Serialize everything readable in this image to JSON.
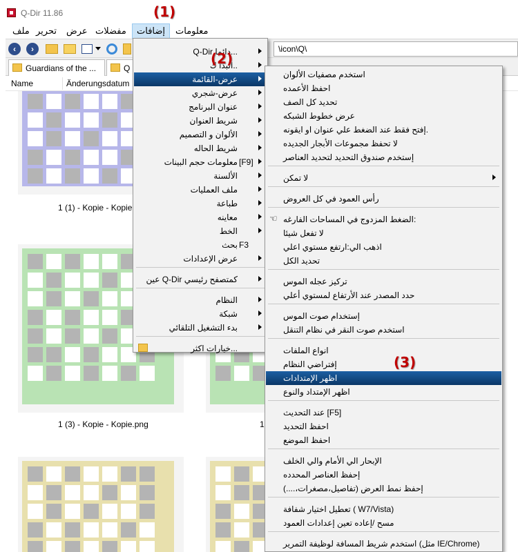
{
  "window": {
    "title": "Q-Dir 11.86"
  },
  "menubar": {
    "file": "ملف",
    "edit": "تحرير",
    "view": "عرض",
    "favorites": "مفضلات",
    "extras": "إضافات",
    "info": "معلومات"
  },
  "toolbar": {
    "path": "\\icon\\Q\\"
  },
  "tabs": [
    {
      "label": "Guardians of the ..."
    },
    {
      "label": "Q"
    }
  ],
  "columns": {
    "name": "Name",
    "modified": "Änderungsdatum"
  },
  "thumbnails": [
    {
      "caption": "1 (1) - Kopie - Kopie.png",
      "color": "#b7b7ea"
    },
    {
      "caption": "1 (3) - Kopie - Kopie.png",
      "color": "#b9e3b4"
    },
    {
      "caption": "1",
      "color": "#b9e3b4"
    },
    {
      "caption": "",
      "color": "#e8e0ad"
    }
  ],
  "callouts": [
    "(1)",
    "(2)",
    "(3)"
  ],
  "extras_menu": [
    {
      "label": "Q-Dir دائما...",
      "submenu": true
    },
    {
      "label": "البدا ك..",
      "submenu": true
    },
    {
      "label": "عرض-القائمة",
      "submenu": true,
      "highlighted": true
    },
    {
      "label": "عرض-شجري",
      "submenu": true
    },
    {
      "label": "عنوان البرنامج",
      "submenu": true
    },
    {
      "label": "شريط العنوان",
      "submenu": true
    },
    {
      "label": "الألوان و التصميم",
      "submenu": true
    },
    {
      "label": "شريط الحاله",
      "submenu": true
    },
    {
      "label": "معلومات حجم البينات",
      "submenu": true,
      "hotkey": "[F9]"
    },
    {
      "label": "الألسنة",
      "submenu": true
    },
    {
      "label": "ملف العمليات",
      "submenu": true
    },
    {
      "label": "طباعة",
      "submenu": true
    },
    {
      "label": "معاينه",
      "submenu": true
    },
    {
      "label": "الخط",
      "submenu": true
    },
    {
      "label": "بحث",
      "submenu": false,
      "hotkey": "F3"
    },
    {
      "label": "عرض الإعدادات",
      "submenu": true
    },
    {
      "label": "عين Q-Dir كمتصفح رئيسي",
      "submenu": true
    },
    {
      "label": "النظام",
      "submenu": true
    },
    {
      "label": "شبكة",
      "submenu": true
    },
    {
      "label": "بدء التشغيل التلقائي",
      "submenu": true
    },
    {
      "label": "خيارات اكثر...",
      "submenu": false
    }
  ],
  "listview_menu": [
    {
      "label": "استخدم مصفيات الألوان"
    },
    {
      "label": "احفظ الأعمده"
    },
    {
      "label": "تحديد كل الصف"
    },
    {
      "label": "عرض خطوط الشبكه"
    },
    {
      "label": "إفتح فقط عند الضغط علي عنوان او ايقونه."
    },
    {
      "label": "لا تحفظ مجموعات الأبجار الجديده"
    },
    {
      "label": "إستخدم صندوق التحديد لتحديد العناصر"
    },
    {
      "label": "لا تمكن",
      "submenu": true
    },
    {
      "label": "رأس العمود في كل العروض"
    },
    {
      "label": "الضغط المزدوج في المساحات الفارغه:"
    },
    {
      "label": "لا تفعل شيئا"
    },
    {
      "label": "اذهب الي:ارتفع مستوي اعلي"
    },
    {
      "label": "تحديد الكل"
    },
    {
      "label": "تركيز عجله الموس"
    },
    {
      "label": "حدد المصدر عند الأرتفاع لمستوي أعلي"
    },
    {
      "label": "إستخدام صوت الموس"
    },
    {
      "label": "استخدم صوت النقر في نظام التنقل"
    },
    {
      "label": "انواع الملفات"
    },
    {
      "label": "إفتراضي النظام"
    },
    {
      "label": "اظهر الإمتدادات",
      "highlighted": true
    },
    {
      "label": "اظهر الإمتداد والنوع"
    },
    {
      "label": "عند التحديث [F5]"
    },
    {
      "label": "احفظ التحديد"
    },
    {
      "label": "احفظ الموضع"
    },
    {
      "label": "الإبحار الي الأمام والي الخلف"
    },
    {
      "label": "إحفظ العناصر المحدده"
    },
    {
      "label": "إحفظ نمط العرض (تفاصيل،مصغرات،....)"
    },
    {
      "label": "تعطيل اختيار شفافة ( W7/Vista)"
    },
    {
      "label": "مسح /إعاده تعين إعدادات العمود"
    },
    {
      "label": "استخدم شريط المسافة لوظيفة التمرير (مثل IE/Chrome)"
    }
  ]
}
